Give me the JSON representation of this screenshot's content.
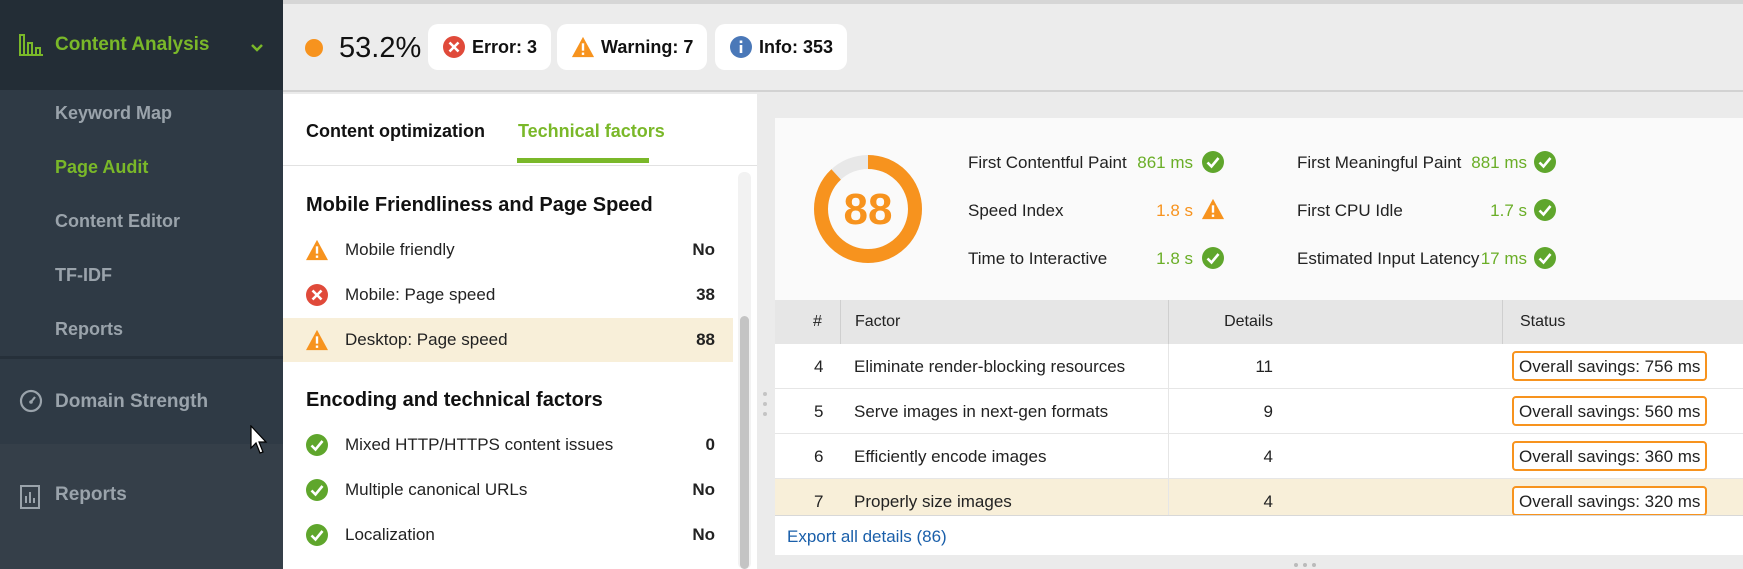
{
  "sidebar": {
    "content_analysis": "Content Analysis",
    "sub_items": [
      "Keyword Map",
      "Page Audit",
      "Content Editor",
      "TF-IDF",
      "Reports"
    ],
    "active_sub": "Page Audit",
    "domain_strength": "Domain Strength",
    "reports": "Reports"
  },
  "topbar": {
    "score": "53.2%",
    "error": "Error: 3",
    "warning": "Warning: 7",
    "info": "Info: 353"
  },
  "tabs": {
    "content": "Content optimization",
    "technical": "Technical factors"
  },
  "sections": [
    {
      "title": "Mobile Friendliness and Page Speed",
      "rows": [
        {
          "icon": "warning-icon",
          "label": "Mobile friendly",
          "value": "No"
        },
        {
          "icon": "error-icon",
          "label": "Mobile: Page speed",
          "value": "38"
        },
        {
          "icon": "warning-icon",
          "label": "Desktop: Page speed",
          "value": "88"
        }
      ]
    },
    {
      "title": "Encoding and technical factors",
      "rows": [
        {
          "icon": "check-icon",
          "label": "Mixed HTTP/HTTPS content issues",
          "value": "0"
        },
        {
          "icon": "check-icon",
          "label": "Multiple canonical URLs",
          "value": "No"
        },
        {
          "icon": "check-icon",
          "label": "Localization",
          "value": "No"
        }
      ]
    }
  ],
  "speed": {
    "score": "88",
    "score_fraction": 0.88,
    "metrics": [
      {
        "label": "First Contentful Paint",
        "value": "861 ms",
        "status": "good"
      },
      {
        "label": "Speed Index",
        "value": "1.8 s",
        "status": "warn"
      },
      {
        "label": "Time to Interactive",
        "value": "1.8 s",
        "status": "good"
      },
      {
        "label": "First Meaningful Paint",
        "value": "881 ms",
        "status": "good"
      },
      {
        "label": "First CPU Idle",
        "value": "1.7 s",
        "status": "good"
      },
      {
        "label": "Estimated Input Latency",
        "value": "17 ms",
        "status": "good"
      }
    ]
  },
  "table": {
    "headers": {
      "num": "#",
      "factor": "Factor",
      "details": "Details",
      "status": "Status"
    },
    "rows": [
      {
        "num": "4",
        "factor": "Eliminate render-blocking resources",
        "details": "11",
        "status": "Overall savings: 756 ms"
      },
      {
        "num": "5",
        "factor": "Serve images in next-gen formats",
        "details": "9",
        "status": "Overall savings: 560 ms"
      },
      {
        "num": "6",
        "factor": "Efficiently encode images",
        "details": "4",
        "status": "Overall savings: 360 ms"
      },
      {
        "num": "7",
        "factor": "Properly size images",
        "details": "4",
        "status": "Overall savings: 320 ms"
      }
    ],
    "export": "Export all details (86)"
  },
  "colors": {
    "accent_green": "#7ab829",
    "warning_orange": "#f7931e",
    "error_red": "#e04a3a",
    "info_blue": "#4a78b8"
  }
}
